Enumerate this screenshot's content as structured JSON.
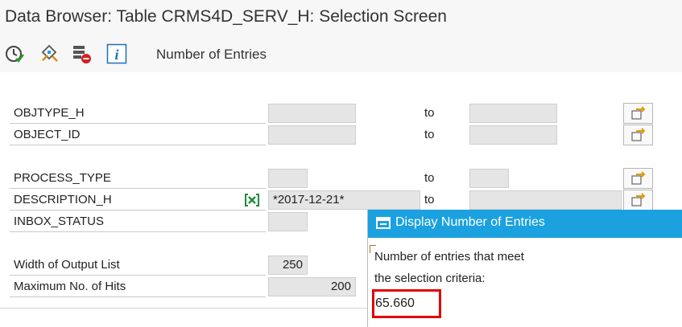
{
  "window": {
    "title": "Data Browser: Table CRMS4D_SERV_H: Selection Screen"
  },
  "toolbar": {
    "icons": [
      "execute-icon",
      "selection-options-icon",
      "delete-entry-icon",
      "info-icon"
    ],
    "number_of_entries_label": "Number of Entries"
  },
  "fields": [
    {
      "label": "OBJTYPE_H",
      "low": "",
      "to_label": "to",
      "high": ""
    },
    {
      "label": "OBJECT_ID",
      "low": "",
      "to_label": "to",
      "high": ""
    },
    {
      "label": "PROCESS_TYPE",
      "low": "",
      "to_label": "to",
      "high": ""
    },
    {
      "label": "DESCRIPTION_H",
      "low": "*2017-12-21*",
      "to_label": "to",
      "high": ""
    },
    {
      "label": "INBOX_STATUS",
      "low": ""
    }
  ],
  "settings": {
    "width_label": "Width of Output List",
    "width_value": "250",
    "max_hits_label": "Maximum No. of Hits",
    "max_hits_value": "200"
  },
  "popup": {
    "title": "Display Number of Entries",
    "text_line1": "Number of entries that meet",
    "text_line2": "the selection criteria:",
    "count": "65.660"
  },
  "colors": {
    "popup_header": "#1ba1df",
    "highlight": "#e00000"
  }
}
